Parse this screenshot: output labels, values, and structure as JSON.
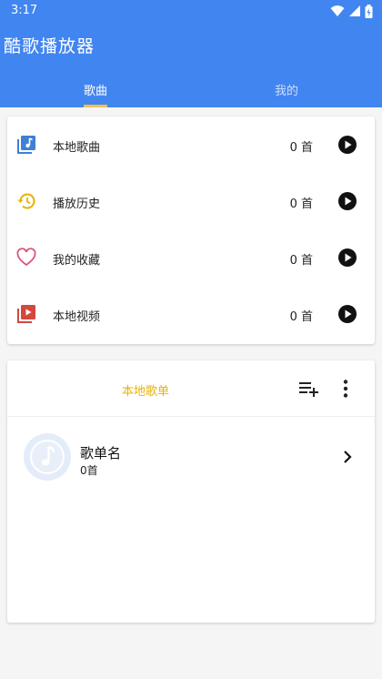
{
  "status_bar": {
    "time": "3:17"
  },
  "app": {
    "title": "酷歌播放器"
  },
  "tabs": [
    {
      "label": "歌曲",
      "active": true
    },
    {
      "label": "我的",
      "active": false
    }
  ],
  "library": {
    "items": [
      {
        "label": "本地歌曲",
        "count": "0 首",
        "icon": "local-music-icon",
        "color": "#3f7fd4"
      },
      {
        "label": "播放历史",
        "count": "0 首",
        "icon": "history-icon",
        "color": "#e8b300"
      },
      {
        "label": "我的收藏",
        "count": "0 首",
        "icon": "heart-icon",
        "color": "#d9577a"
      },
      {
        "label": "本地视频",
        "count": "0 首",
        "icon": "video-icon",
        "color": "#d3483d"
      }
    ]
  },
  "playlists": {
    "title": "本地歌单",
    "items": [
      {
        "name": "歌单名",
        "count": "0首"
      }
    ]
  },
  "colors": {
    "primary": "#4185f0",
    "accent": "#f0c24a",
    "title_gold": "#e8b300"
  }
}
